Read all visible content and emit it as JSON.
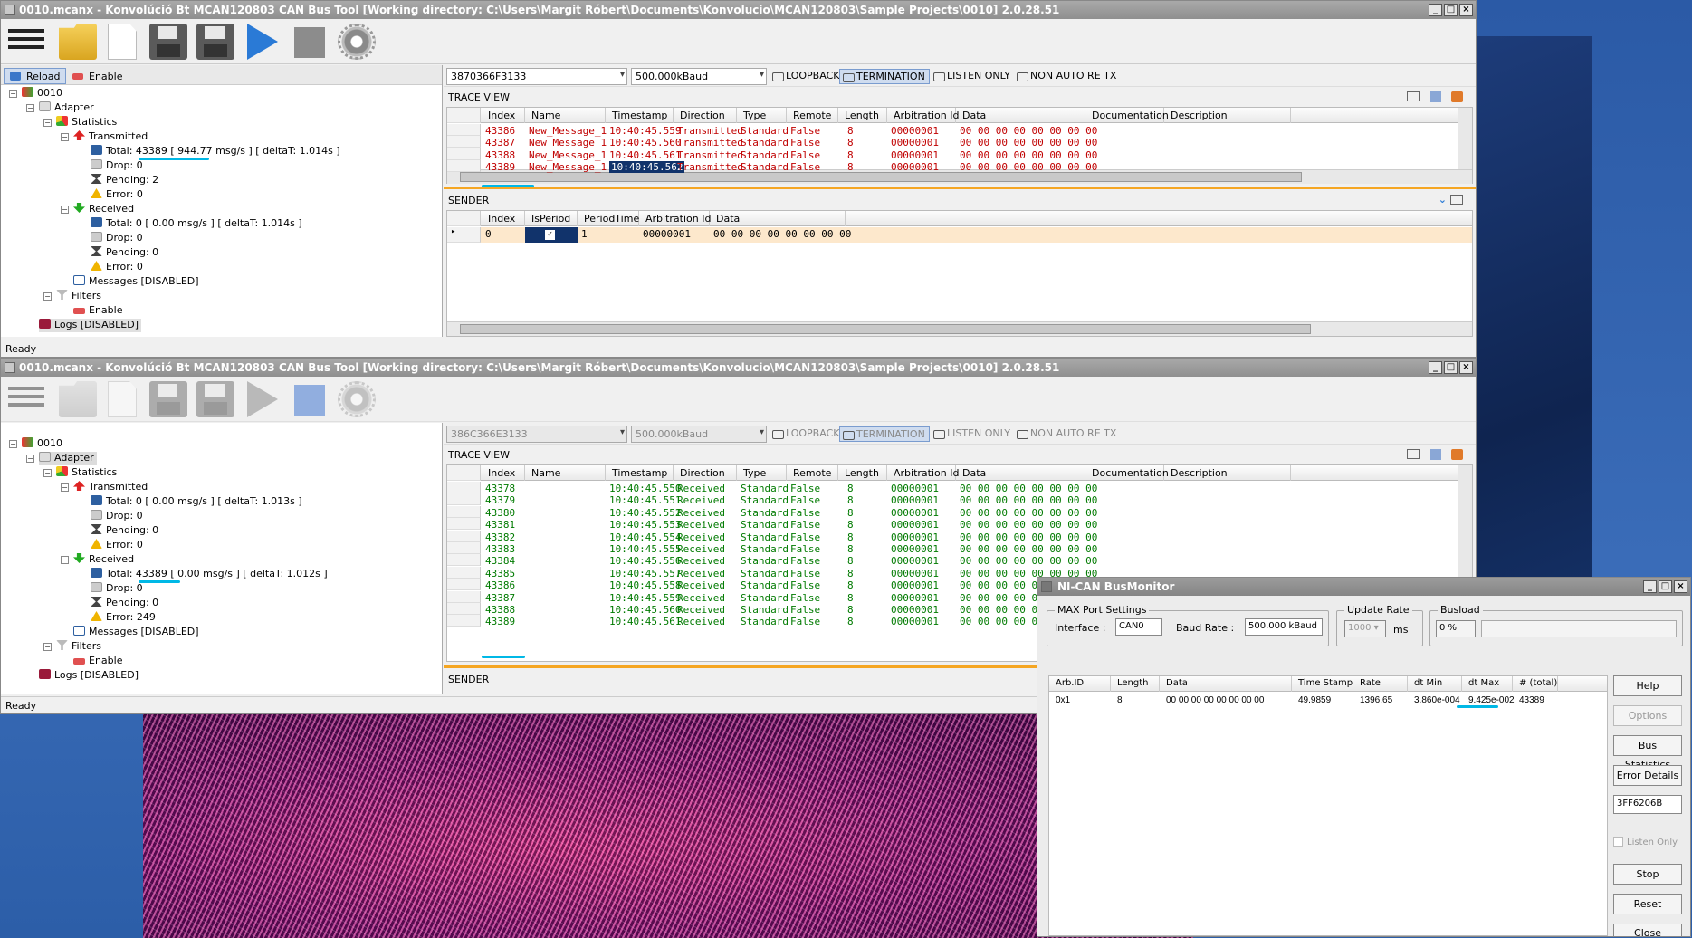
{
  "colors": {
    "accent": "#00b8e6",
    "sent": "#c00000",
    "received": "#007a00",
    "orange_bar": "#f5a623",
    "selection": "#11336b"
  },
  "win1": {
    "title": "0010.mcanx - Konvolúció Bt MCAN120803 CAN Bus Tool [Working directory: C:\\Users\\Margit Róbert\\Documents\\Konvolucio\\MCAN120803\\Sample Projects\\0010] 2.0.28.51",
    "controls": {
      "min": "_",
      "max": "□",
      "close": "×"
    },
    "toolbar": {
      "icons": [
        "menu-icon",
        "open-folder-icon",
        "new-file-icon",
        "save-icon",
        "save-as-icon",
        "play-icon",
        "stop-icon",
        "settings-gear-icon"
      ]
    },
    "left": {
      "reload": "Reload",
      "enable": "Enable",
      "tree": {
        "root": "0010",
        "adapter": "Adapter",
        "statistics": "Statistics",
        "transmitted": "Transmitted",
        "tx_total": "Total: 43389 [ 944.77 msg/s ]  [ deltaT: 1.014s ]",
        "tx_drop": "Drop: 0",
        "tx_pending": "Pending: 2",
        "tx_error": "Error: 0",
        "received": "Received",
        "rx_total": "Total: 0 [ 0.00 msg/s ]  [ deltaT: 1.014s ]",
        "rx_drop": "Drop: 0",
        "rx_pending": "Pending: 0",
        "rx_error": "Error: 0",
        "messages": "Messages [DISABLED]",
        "filters": "Filters",
        "filters_enable": "Enable",
        "logs": "Logs [DISABLED]"
      }
    },
    "options": {
      "serial": "3870366F3133",
      "baud": "500.000kBaud",
      "loopback": "LOOPBACK",
      "termination": "TERMINATION",
      "listen_only": "LISTEN ONLY",
      "non_auto_re_tx": "NON AUTO RE TX"
    },
    "trace": {
      "title": "TRACE VIEW",
      "columns": [
        "Index",
        "Name",
        "Timestamp",
        "Direction",
        "Type",
        "Remote",
        "Length",
        "Arbitration Id",
        "Data",
        "Documentation",
        "Description"
      ],
      "rows": [
        [
          "43386",
          "New_Message_1",
          "10:40:45.559",
          "Transmitted",
          "Standard",
          "False",
          "8",
          "00000001",
          "00 00 00 00 00 00 00 00"
        ],
        [
          "43387",
          "New_Message_1",
          "10:40:45.560",
          "Transmitted",
          "Standard",
          "False",
          "8",
          "00000001",
          "00 00 00 00 00 00 00 00"
        ],
        [
          "43388",
          "New_Message_1",
          "10:40:45.561",
          "Transmitted",
          "Standard",
          "False",
          "8",
          "00000001",
          "00 00 00 00 00 00 00 00"
        ],
        [
          "43389",
          "New_Message_1",
          "10:40:45.562",
          "Transmitted",
          "Standard",
          "False",
          "8",
          "00000001",
          "00 00 00 00 00 00 00 00"
        ]
      ]
    },
    "sender": {
      "title": "SENDER",
      "columns": [
        "Index",
        "IsPeriod",
        "PeriodTime",
        "Arbitration Id",
        "Data"
      ],
      "row": {
        "index": "0",
        "period": "1",
        "arb": "00000001",
        "data": "00 00 00 00 00 00 00 00"
      }
    },
    "status": "Ready"
  },
  "win2": {
    "title": "0010.mcanx - Konvolúció Bt MCAN120803 CAN Bus Tool [Working directory: C:\\Users\\Margit Róbert\\Documents\\Konvolucio\\MCAN120803\\Sample Projects\\0010] 2.0.28.51",
    "left": {
      "tree": {
        "root": "0010",
        "adapter": "Adapter",
        "statistics": "Statistics",
        "transmitted": "Transmitted",
        "tx_total": "Total: 0 [ 0.00 msg/s ]  [ deltaT: 1.013s ]",
        "tx_drop": "Drop: 0",
        "tx_pending": "Pending: 0",
        "tx_error": "Error: 0",
        "received": "Received",
        "rx_total": "Total: 43389 [ 0.00 msg/s ]  [ deltaT: 1.012s ]",
        "rx_drop": "Drop: 0",
        "rx_pending": "Pending: 0",
        "rx_error": "Error: 249",
        "messages": "Messages [DISABLED]",
        "filters": "Filters",
        "filters_enable": "Enable",
        "logs": "Logs [DISABLED]"
      }
    },
    "options": {
      "serial": "386C366E3133",
      "baud": "500.000kBaud",
      "loopback": "LOOPBACK",
      "termination": "TERMINATION",
      "listen_only": "LISTEN ONLY",
      "non_auto_re_tx": "NON AUTO RE TX"
    },
    "trace": {
      "title": "TRACE VIEW",
      "rows": [
        [
          "43378",
          "",
          "10:40:45.550",
          "Received",
          "Standard",
          "False",
          "8",
          "00000001",
          "00 00 00 00 00 00 00 00"
        ],
        [
          "43379",
          "",
          "10:40:45.551",
          "Received",
          "Standard",
          "False",
          "8",
          "00000001",
          "00 00 00 00 00 00 00 00"
        ],
        [
          "43380",
          "",
          "10:40:45.552",
          "Received",
          "Standard",
          "False",
          "8",
          "00000001",
          "00 00 00 00 00 00 00 00"
        ],
        [
          "43381",
          "",
          "10:40:45.553",
          "Received",
          "Standard",
          "False",
          "8",
          "00000001",
          "00 00 00 00 00 00 00 00"
        ],
        [
          "43382",
          "",
          "10:40:45.554",
          "Received",
          "Standard",
          "False",
          "8",
          "00000001",
          "00 00 00 00 00 00 00 00"
        ],
        [
          "43383",
          "",
          "10:40:45.555",
          "Received",
          "Standard",
          "False",
          "8",
          "00000001",
          "00 00 00 00 00 00 00 00"
        ],
        [
          "43384",
          "",
          "10:40:45.556",
          "Received",
          "Standard",
          "False",
          "8",
          "00000001",
          "00 00 00 00 00 00 00 00"
        ],
        [
          "43385",
          "",
          "10:40:45.557",
          "Received",
          "Standard",
          "False",
          "8",
          "00000001",
          "00 00 00 00 00 00 00 00"
        ],
        [
          "43386",
          "",
          "10:40:45.558",
          "Received",
          "Standard",
          "False",
          "8",
          "00000001",
          "00 00 00 00 00 00 00 00"
        ],
        [
          "43387",
          "",
          "10:40:45.559",
          "Received",
          "Standard",
          "False",
          "8",
          "00000001",
          "00 00 00 00 00 00 00 00"
        ],
        [
          "43388",
          "",
          "10:40:45.560",
          "Received",
          "Standard",
          "False",
          "8",
          "00000001",
          "00 00 00 00 00 00 00 00"
        ],
        [
          "43389",
          "",
          "10:40:45.561",
          "Received",
          "Standard",
          "False",
          "8",
          "00000001",
          "00 00 00 00 00 00 00 00"
        ]
      ]
    },
    "sender": {
      "title": "SENDER"
    },
    "status": "Ready"
  },
  "ni": {
    "title": "NI-CAN BusMonitor",
    "port": {
      "group": "MAX Port Settings",
      "interface_label": "Interface :",
      "interface": "CAN0",
      "baud_label": "Baud Rate :",
      "baud": "500.000 kBaud"
    },
    "update": {
      "group": "Update Rate",
      "value": "1000",
      "unit": "ms"
    },
    "busload": {
      "group": "Busload",
      "value": "0 %"
    },
    "columns": [
      "Arb.ID",
      "Length",
      "Data",
      "Time Stamp",
      "Rate",
      "dt Min",
      "dt Max",
      "# (total)"
    ],
    "row": [
      "0x1",
      "8",
      "00 00 00 00 00 00 00 00",
      "49.9859",
      "1396.65",
      "3.860e-004",
      "9.425e-002",
      "43389"
    ],
    "buttons": {
      "help": "Help",
      "options": "Options",
      "bus_statistics": "Bus Statistics",
      "error_details": "Error Details",
      "serial": "3FF6206B",
      "listen_only": "Listen Only",
      "stop": "Stop",
      "reset": "Reset",
      "close": "Close"
    }
  }
}
